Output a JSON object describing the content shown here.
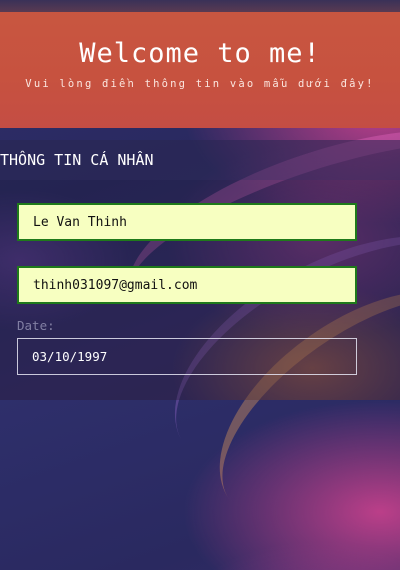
{
  "header": {
    "title": "Welcome to me!",
    "subtitle": "Vui lòng điền thông tin vào mẫu dưới đây!"
  },
  "section": {
    "title": "THÔNG TIN CÁ NHÂN"
  },
  "form": {
    "name_value": "Le Van Thinh",
    "email_value": "thinh031097@gmail.com",
    "date_label": "Date:",
    "date_value": "03/10/1997"
  },
  "colors": {
    "header_bg": "#c85741",
    "field_bg": "#f7ffc1",
    "field_border": "#1f7a1a"
  }
}
